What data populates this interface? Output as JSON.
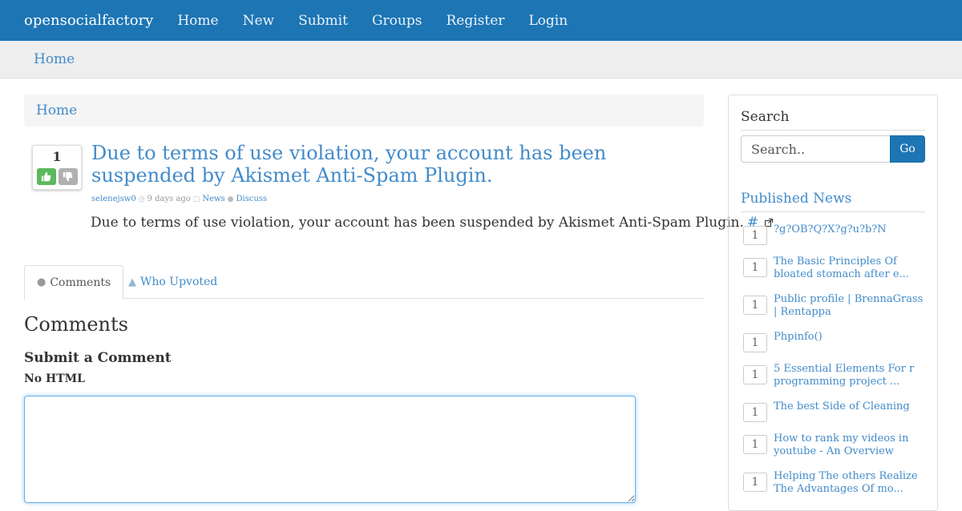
{
  "navbar": {
    "brand": "opensocialfactory",
    "items": [
      "Home",
      "New",
      "Submit",
      "Groups",
      "Register",
      "Login"
    ]
  },
  "subbar": {
    "home": "Home"
  },
  "breadcrumb": {
    "home": "Home"
  },
  "post": {
    "votes": "1",
    "title": "Due to terms of use violation, your account has been suspended by Akismet Anti-Spam Plugin.",
    "author": "selenejsw0",
    "time": "9 days ago",
    "category": "News",
    "discuss": "Discuss",
    "body": "Due to terms of use violation, your account has been suspended by Akismet Anti-Spam Plugin.",
    "link": "#"
  },
  "tabs": {
    "comments": "Comments",
    "who_upvoted": "Who Upvoted"
  },
  "comments": {
    "heading": "Comments",
    "submit_heading": "Submit a Comment",
    "no_html": "No HTML"
  },
  "sidebar": {
    "search_title": "Search",
    "search_placeholder": "Search..",
    "go": "Go",
    "published_title": "Published News",
    "news": [
      {
        "count": "1",
        "title": "?ց?OB?Q?X?g?u?b?N"
      },
      {
        "count": "1",
        "title": "The Basic Principles Of bloated stomach after e..."
      },
      {
        "count": "1",
        "title": "Public profile | BrennaGrass | Rentappa"
      },
      {
        "count": "1",
        "title": "Phpinfo()"
      },
      {
        "count": "1",
        "title": "5 Essential Elements For r programming project ..."
      },
      {
        "count": "1",
        "title": "The best Side of Cleaning"
      },
      {
        "count": "1",
        "title": "How to rank my videos in youtube - An Overview"
      },
      {
        "count": "1",
        "title": "Helping The others Realize The Advantages Of mo..."
      }
    ]
  },
  "colors": {
    "primary": "#1d75b4",
    "link": "#428bca",
    "upvote": "#5cb85c",
    "downvote": "#b0b0b0"
  }
}
